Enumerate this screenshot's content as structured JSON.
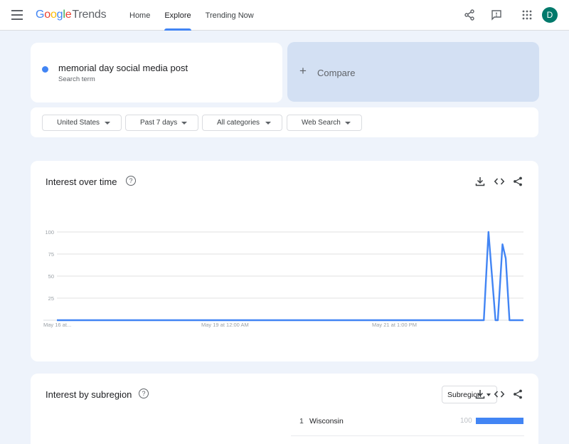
{
  "header": {
    "logo_letters": [
      "G",
      "o",
      "o",
      "g",
      "l",
      "e"
    ],
    "logo_suffix": "Trends",
    "nav": [
      {
        "label": "Home",
        "active": false
      },
      {
        "label": "Explore",
        "active": true
      },
      {
        "label": "Trending Now",
        "active": false
      }
    ],
    "avatar_initial": "D",
    "icons": [
      "menu-icon",
      "share-icon",
      "feedback-icon",
      "apps-grid-icon"
    ]
  },
  "search": {
    "term": "memorial day social media post",
    "term_sublabel": "Search term",
    "compare_label": "Compare",
    "term_color": "#4285f4"
  },
  "filters": [
    {
      "label": "United States"
    },
    {
      "label": "Past 7 days"
    },
    {
      "label": "All categories"
    },
    {
      "label": "Web Search"
    }
  ],
  "interest_over_time": {
    "title": "Interest over time",
    "help_icon": "help-icon",
    "actions": [
      "download-icon",
      "embed-code-icon",
      "share-icon"
    ]
  },
  "chart_data": {
    "type": "line",
    "title": "Interest over time",
    "xlabel": "",
    "ylabel": "",
    "ylim": [
      0,
      100
    ],
    "y_ticks": [
      25,
      50,
      75,
      100
    ],
    "x_tick_labels": [
      "May 16 at...",
      "May 19 at 12:00 AM",
      "May 21 at 1:00 PM"
    ],
    "grid": true,
    "series": [
      {
        "color": "#4285f4",
        "x": [
          0,
          0.9,
          0.915,
          0.925,
          0.94,
          0.945,
          0.955,
          0.962,
          0.97,
          1.0
        ],
        "y": [
          0,
          0,
          0,
          100,
          0,
          0,
          86,
          70,
          0,
          0
        ]
      }
    ]
  },
  "interest_by_subregion": {
    "title": "Interest by subregion",
    "help_icon": "help-icon",
    "dropdown_value": "Subregion",
    "actions": [
      "download-icon",
      "embed-code-icon",
      "share-icon"
    ],
    "rows": [
      {
        "rank": "1",
        "name": "Wisconsin",
        "value": "100",
        "fraction": 1.0
      }
    ],
    "bar_color": "#4285f4"
  }
}
